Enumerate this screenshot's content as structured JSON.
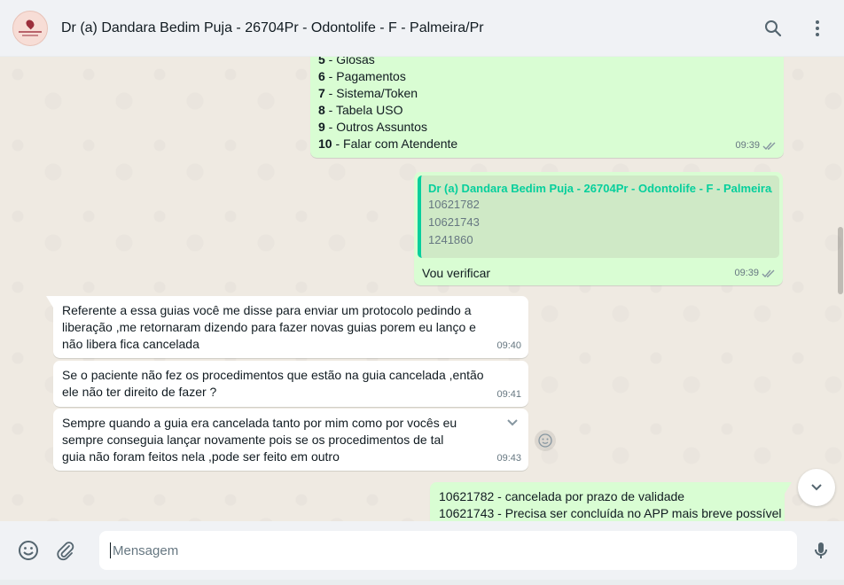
{
  "header": {
    "title": "Dr (a) Dandara Bedim Puja - 26704Pr - Odontolife - F - Palmeira/Pr",
    "avatar_icon": "clinic-logo-avatar",
    "search_icon": "search-icon",
    "menu_icon": "kebab-menu-icon"
  },
  "messages": {
    "menu_list": {
      "rows": [
        {
          "num": "5",
          "label": " - Glosas"
        },
        {
          "num": "6",
          "label": " - Pagamentos"
        },
        {
          "num": "7",
          "label": " - Sistema/Token"
        },
        {
          "num": "8",
          "label": " - Tabela USO"
        },
        {
          "num": "9",
          "label": " - Outros Assuntos"
        },
        {
          "num": "10",
          "label": " - Falar com Atendente"
        }
      ],
      "time": "09:39"
    },
    "reply": {
      "quote_author": "Dr (a) Dandara Bedim Puja - 26704Pr - Odontolife - F - Palmeira/Pr",
      "quote_lines": [
        "10621782",
        "10621743",
        "1241860"
      ],
      "text": "Vou verificar",
      "time": "09:39"
    },
    "incoming": [
      {
        "text": "Referente a essa guias você me disse para enviar um protocolo pedindo a liberação ,me retornaram dizendo para fazer novas guias porem eu lanço e não libera fica cancelada",
        "time": "09:40"
      },
      {
        "text": "Se o paciente não fez os procedimentos que estão na guia cancelada ,então ele não ter direito de fazer ?",
        "time": "09:41"
      },
      {
        "text": "Sempre quando a guia era cancelada tanto por mim como por vocês eu sempre conseguia lançar novamente pois se os procedimentos de tal guia não foram feitos nela ,pode ser feito em outro",
        "time": "09:43"
      }
    ],
    "last_out": {
      "lines": [
        "10621782 - cancelada por prazo de validade",
        "10621743 - Precisa ser concluída no APP mais breve possível"
      ]
    }
  },
  "footer": {
    "placeholder": "Mensagem"
  },
  "colors": {
    "outgoing_bubble": "#d9fdd3",
    "incoming_bubble": "#ffffff",
    "quote_accent": "#06cf9c",
    "chat_background": "#efeae2"
  }
}
